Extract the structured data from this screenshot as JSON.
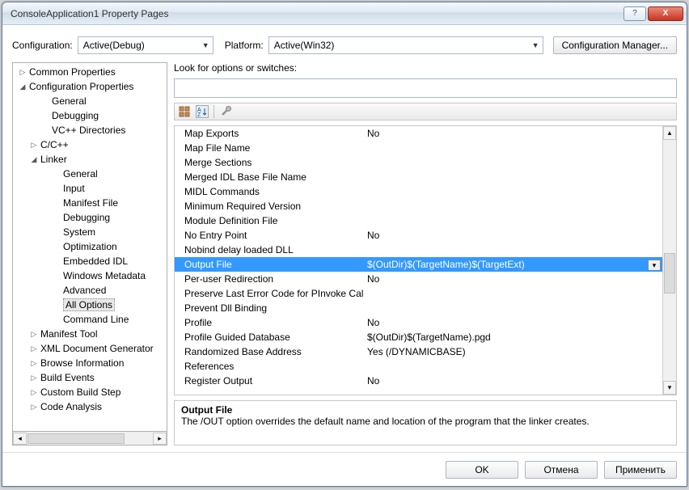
{
  "window": {
    "title": "ConsoleApplication1 Property Pages"
  },
  "titlebar_buttons": {
    "help": "?",
    "close": "X"
  },
  "config": {
    "config_label": "Configuration:",
    "config_value": "Active(Debug)",
    "platform_label": "Platform:",
    "platform_value": "Active(Win32)",
    "manager_button": "Configuration Manager..."
  },
  "tree": [
    {
      "indent": 0,
      "exp": "▷",
      "label": "Common Properties"
    },
    {
      "indent": 0,
      "exp": "◢",
      "label": "Configuration Properties"
    },
    {
      "indent": 2,
      "exp": "",
      "label": "General"
    },
    {
      "indent": 2,
      "exp": "",
      "label": "Debugging"
    },
    {
      "indent": 2,
      "exp": "",
      "label": "VC++ Directories"
    },
    {
      "indent": 1,
      "exp": "▷",
      "label": "C/C++"
    },
    {
      "indent": 1,
      "exp": "◢",
      "label": "Linker"
    },
    {
      "indent": 3,
      "exp": "",
      "label": "General"
    },
    {
      "indent": 3,
      "exp": "",
      "label": "Input"
    },
    {
      "indent": 3,
      "exp": "",
      "label": "Manifest File"
    },
    {
      "indent": 3,
      "exp": "",
      "label": "Debugging"
    },
    {
      "indent": 3,
      "exp": "",
      "label": "System"
    },
    {
      "indent": 3,
      "exp": "",
      "label": "Optimization"
    },
    {
      "indent": 3,
      "exp": "",
      "label": "Embedded IDL"
    },
    {
      "indent": 3,
      "exp": "",
      "label": "Windows Metadata"
    },
    {
      "indent": 3,
      "exp": "",
      "label": "Advanced"
    },
    {
      "indent": 3,
      "exp": "",
      "label": "All Options",
      "selected": true
    },
    {
      "indent": 3,
      "exp": "",
      "label": "Command Line"
    },
    {
      "indent": 1,
      "exp": "▷",
      "label": "Manifest Tool"
    },
    {
      "indent": 1,
      "exp": "▷",
      "label": "XML Document Generator"
    },
    {
      "indent": 1,
      "exp": "▷",
      "label": "Browse Information"
    },
    {
      "indent": 1,
      "exp": "▷",
      "label": "Build Events"
    },
    {
      "indent": 1,
      "exp": "▷",
      "label": "Custom Build Step"
    },
    {
      "indent": 1,
      "exp": "▷",
      "label": "Code Analysis"
    }
  ],
  "search_label": "Look for options or switches:",
  "search_value": "",
  "toolbar_icons": {
    "categorized": "categorized-icon",
    "alpha": "alpha-sort-icon",
    "props": "properties-icon"
  },
  "grid": [
    {
      "name": "Map Exports",
      "value": "No"
    },
    {
      "name": "Map File Name",
      "value": ""
    },
    {
      "name": "Merge Sections",
      "value": ""
    },
    {
      "name": "Merged IDL Base File Name",
      "value": ""
    },
    {
      "name": "MIDL Commands",
      "value": ""
    },
    {
      "name": "Minimum Required Version",
      "value": ""
    },
    {
      "name": "Module Definition File",
      "value": ""
    },
    {
      "name": "No Entry Point",
      "value": "No"
    },
    {
      "name": "Nobind delay loaded DLL",
      "value": ""
    },
    {
      "name": "Output File",
      "value": "$(OutDir)$(TargetName)$(TargetExt)",
      "selected": true
    },
    {
      "name": "Per-user Redirection",
      "value": "No"
    },
    {
      "name": "Preserve Last Error Code for PInvoke Calls",
      "value": ""
    },
    {
      "name": "Prevent Dll Binding",
      "value": ""
    },
    {
      "name": "Profile",
      "value": "No"
    },
    {
      "name": "Profile Guided Database",
      "value": "$(OutDir)$(TargetName).pgd"
    },
    {
      "name": "Randomized Base Address",
      "value": "Yes (/DYNAMICBASE)"
    },
    {
      "name": "References",
      "value": ""
    },
    {
      "name": "Register Output",
      "value": "No"
    }
  ],
  "description": {
    "title": "Output File",
    "text": "The /OUT option overrides the default name and location of the program that the linker creates."
  },
  "footer": {
    "ok": "OK",
    "cancel": "Отмена",
    "apply": "Применить"
  },
  "colors": {
    "selection": "#3399ff",
    "arrow": "#2e8b1a"
  }
}
